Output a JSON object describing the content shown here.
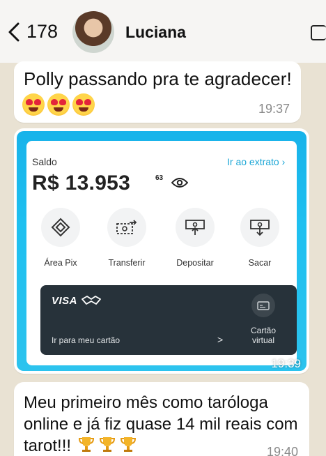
{
  "header": {
    "back_count": "178",
    "contact_name": "Luciana"
  },
  "messages": [
    {
      "text": "Polly passando pra te agradecer!",
      "emojis": [
        "heart-eyes-emoji",
        "heart-eyes-emoji",
        "heart-eyes-emoji"
      ],
      "time": "19:37"
    },
    {
      "type": "image",
      "time": "19:39",
      "screenshot": {
        "saldo_label": "Saldo",
        "extrato_link": "Ir ao extrato",
        "amount": "R$ 13.953",
        "cents": "63",
        "actions": [
          {
            "label": "Área Pix",
            "icon": "pix-icon"
          },
          {
            "label": "Transferir",
            "icon": "transfer-icon"
          },
          {
            "label": "Depositar",
            "icon": "deposit-icon"
          },
          {
            "label": "Sacar",
            "icon": "withdraw-icon"
          }
        ],
        "card": {
          "brand": "VISA",
          "link": "Ir para meu cartão",
          "chevron": ">",
          "virtual_label": "Cartão virtual"
        },
        "colors": {
          "accent": "#1aa6d6",
          "background": "#18b3ea",
          "card": "#27323a"
        }
      }
    },
    {
      "text": "Meu primeiro mês como taróloga online e já fiz quase 14 mil reais com tarot!!!",
      "emojis": [
        "trophy-emoji",
        "trophy-emoji",
        "trophy-emoji"
      ],
      "time": "19:40"
    }
  ]
}
